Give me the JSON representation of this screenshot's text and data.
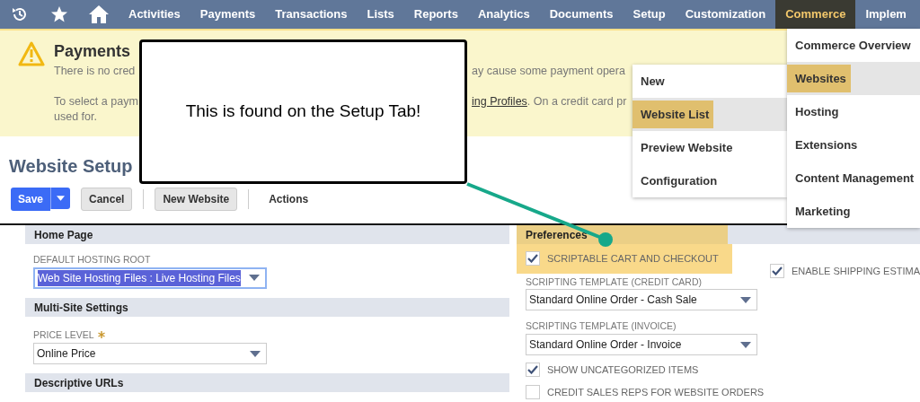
{
  "navbar": {
    "icons": [
      {
        "kind": "history"
      },
      {
        "kind": "star"
      },
      {
        "kind": "home"
      }
    ],
    "items": [
      {
        "label": "Activities",
        "selected": false
      },
      {
        "label": "Payments",
        "selected": false
      },
      {
        "label": "Transactions",
        "selected": false
      },
      {
        "label": "Lists",
        "selected": false
      },
      {
        "label": "Reports",
        "selected": false
      },
      {
        "label": "Analytics",
        "selected": false
      },
      {
        "label": "Documents",
        "selected": false
      },
      {
        "label": "Setup",
        "selected": false
      },
      {
        "label": "Customization",
        "selected": false
      },
      {
        "label": "Commerce",
        "selected": true
      },
      {
        "label": "Implem",
        "selected": false
      }
    ]
  },
  "alert": {
    "title": "Payments",
    "lines": [
      {
        "left": "There is no cred",
        "right": [
          {
            "kind": "text",
            "text": "ay cause some payment opera"
          }
        ]
      },
      {
        "left": "To select a paym",
        "right": [
          {
            "kind": "link",
            "text": "ing Profiles"
          },
          {
            "kind": "text",
            "text": ". On a credit card pr"
          }
        ]
      },
      {
        "left": "used for."
      }
    ]
  },
  "page_title": "Website Setup",
  "toolbar": [
    {
      "kind": "split",
      "label": "Save"
    },
    {
      "kind": "button",
      "label": "Cancel"
    },
    {
      "kind": "divider"
    },
    {
      "kind": "button",
      "label": "New Website"
    },
    {
      "kind": "divider"
    },
    {
      "kind": "link",
      "label": "Actions"
    }
  ],
  "left_column": [
    {
      "kind": "header",
      "label": "Home Page"
    },
    {
      "kind": "select",
      "label": "DEFAULT HOSTING ROOT",
      "value": "Web Site Hosting Files : Live Hosting Files",
      "required": false,
      "focused": true
    },
    {
      "kind": "header",
      "label": "Multi-Site Settings"
    },
    {
      "kind": "select",
      "label": "PRICE LEVEL",
      "value": "Online Price",
      "required": true,
      "focused": false
    },
    {
      "kind": "header",
      "label": "Descriptive URLs"
    }
  ],
  "preferences": {
    "header": "Preferences",
    "main": [
      {
        "kind": "checkbox",
        "label": "SCRIPTABLE CART AND CHECKOUT",
        "checked": true
      },
      {
        "kind": "select",
        "label": "SCRIPTING TEMPLATE (CREDIT CARD)",
        "value": "Standard Online Order - Cash Sale"
      },
      {
        "kind": "select",
        "label": "SCRIPTING TEMPLATE (INVOICE)",
        "value": "Standard Online Order - Invoice"
      },
      {
        "kind": "checkbox",
        "label": "SHOW UNCATEGORIZED ITEMS",
        "checked": true
      },
      {
        "kind": "checkbox",
        "label": "CREDIT SALES REPS FOR WEBSITE ORDERS",
        "checked": false
      }
    ],
    "side": [
      {
        "kind": "checkbox",
        "label": "ENABLE SHIPPING ESTIMA",
        "checked": true
      }
    ]
  },
  "commerce_menu": [
    {
      "label": "Commerce Overview",
      "selected": false
    },
    {
      "label": "Websites",
      "selected": true
    },
    {
      "label": "Hosting",
      "selected": false
    },
    {
      "label": "Extensions",
      "selected": false
    },
    {
      "label": "Content Management",
      "selected": false
    },
    {
      "label": "Marketing",
      "selected": false
    }
  ],
  "submenu": [
    {
      "label": "New",
      "selected": false
    },
    {
      "label": "Website List",
      "selected": true
    },
    {
      "label": "Preview Website",
      "selected": false
    },
    {
      "label": "Configuration",
      "selected": false
    }
  ],
  "callout": {
    "text": "This is found on the Setup Tab!"
  }
}
